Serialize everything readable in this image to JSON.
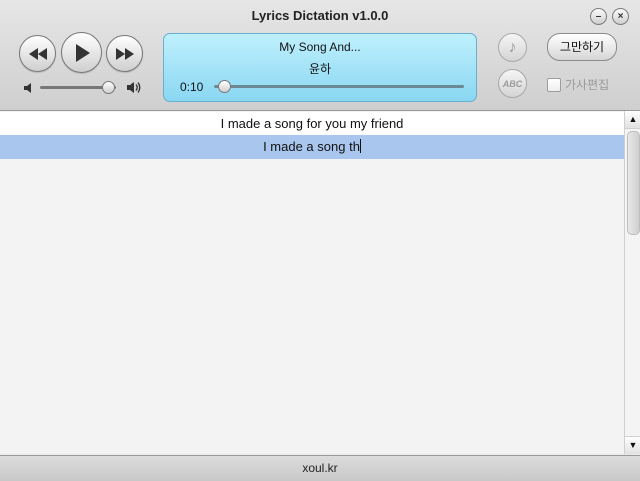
{
  "window": {
    "title": "Lyrics Dictation v1.0.0",
    "min_glyph": "⊖",
    "close_glyph": "⊗"
  },
  "player": {
    "song_title": "My Song And...",
    "artist": "윤하",
    "time": "0:10",
    "progress_fraction": 0.04,
    "volume_fraction": 0.9,
    "icons": [
      "rewind-icon",
      "play-icon",
      "fast-forward-icon",
      "volume-low-icon",
      "volume-high-icon"
    ]
  },
  "right_panel": {
    "quit_label": "그만하기",
    "edit_lyrics_label": "가사편집",
    "edit_lyrics_checked": false,
    "note_glyph": "♪",
    "abc_glyph": "ABC"
  },
  "lyrics": {
    "line1": "I made a song for you my friend",
    "line2_typed": "I made a song th"
  },
  "status": {
    "text": "xoul.kr"
  },
  "colors": {
    "display_bg": "#a9e3f7",
    "highlight": "#a9c7ee"
  }
}
